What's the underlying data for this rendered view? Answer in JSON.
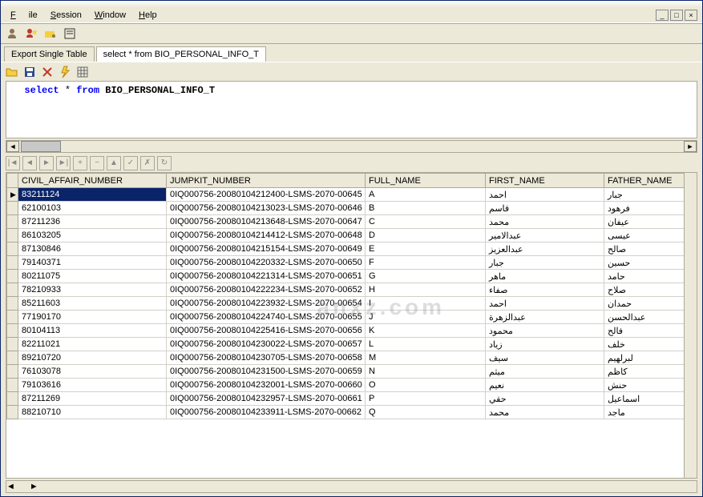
{
  "menu": {
    "file": "File",
    "session": "Session",
    "window": "Window",
    "help": "Help"
  },
  "tabs": {
    "export": "Export Single Table",
    "query": "select * from BIO_PERSONAL_INFO_T"
  },
  "sql": {
    "select": "select",
    "star": " * ",
    "from": "from",
    "table": " BIO_PERSONAL_INFO_T"
  },
  "columns": [
    "CIVIL_AFFAIR_NUMBER",
    "JUMPKIT_NUMBER",
    "FULL_NAME",
    "FIRST_NAME",
    "FATHER_NAME"
  ],
  "rows": [
    {
      "sel": true,
      "c": [
        "83211124",
        "0IQ000756-20080104212400-LSMS-2070-00645",
        "A",
        "احمد",
        "جبار"
      ]
    },
    {
      "c": [
        "62100103",
        "0IQ000756-20080104213023-LSMS-2070-00646",
        "B",
        "قاسم",
        "فرهود"
      ]
    },
    {
      "c": [
        "87211236",
        "0IQ000756-20080104213648-LSMS-2070-00647",
        "C",
        "محمد",
        "عيفان"
      ]
    },
    {
      "c": [
        "86103205",
        "0IQ000756-20080104214412-LSMS-2070-00648",
        "D",
        "عبدالامير",
        "عيسى"
      ]
    },
    {
      "c": [
        "87130846",
        "0IQ000756-20080104215154-LSMS-2070-00649",
        "E",
        "عبدالعزيز",
        "صالح"
      ]
    },
    {
      "c": [
        "79140371",
        "0IQ000756-20080104220332-LSMS-2070-00650",
        "F",
        "جبار",
        "حسين"
      ]
    },
    {
      "c": [
        "80211075",
        "0IQ000756-20080104221314-LSMS-2070-00651",
        "G",
        "ماهر",
        "حامد"
      ]
    },
    {
      "c": [
        "78210933",
        "0IQ000756-20080104222234-LSMS-2070-00652",
        "H",
        "صفاء",
        "صلاح"
      ]
    },
    {
      "c": [
        "85211603",
        "0IQ000756-20080104223932-LSMS-2070-00654",
        "I",
        "احمد",
        "حمدان"
      ]
    },
    {
      "c": [
        "77190170",
        "0IQ000756-20080104224740-LSMS-2070-00655",
        "J",
        "عبدالزهرة",
        "عبدالحسن"
      ]
    },
    {
      "c": [
        "80104113",
        "0IQ000756-20080104225416-LSMS-2070-00656",
        "K",
        "محمود",
        "فالح"
      ]
    },
    {
      "c": [
        "82211021",
        "0IQ000756-20080104230022-LSMS-2070-00657",
        "L",
        "زياد",
        "خلف"
      ]
    },
    {
      "c": [
        "89210720",
        "0IQ000756-20080104230705-LSMS-2070-00658",
        "M",
        "سيف",
        "لبرلهيم"
      ]
    },
    {
      "c": [
        "76103078",
        "0IQ000756-20080104231500-LSMS-2070-00659",
        "N",
        "ميثم",
        "كاظم"
      ]
    },
    {
      "c": [
        "79103616",
        "0IQ000756-20080104232001-LSMS-2070-00660",
        "O",
        "نعيم",
        "حنش"
      ]
    },
    {
      "c": [
        "87211269",
        "0IQ000756-20080104232957-LSMS-2070-00661",
        "P",
        "حقي",
        "اسماعيل"
      ]
    },
    {
      "c": [
        "88210710",
        "0IQ000756-20080104233911-LSMS-2070-00662",
        "Q",
        "محمد",
        "ماجد"
      ]
    }
  ],
  "watermark": "anxz.com"
}
